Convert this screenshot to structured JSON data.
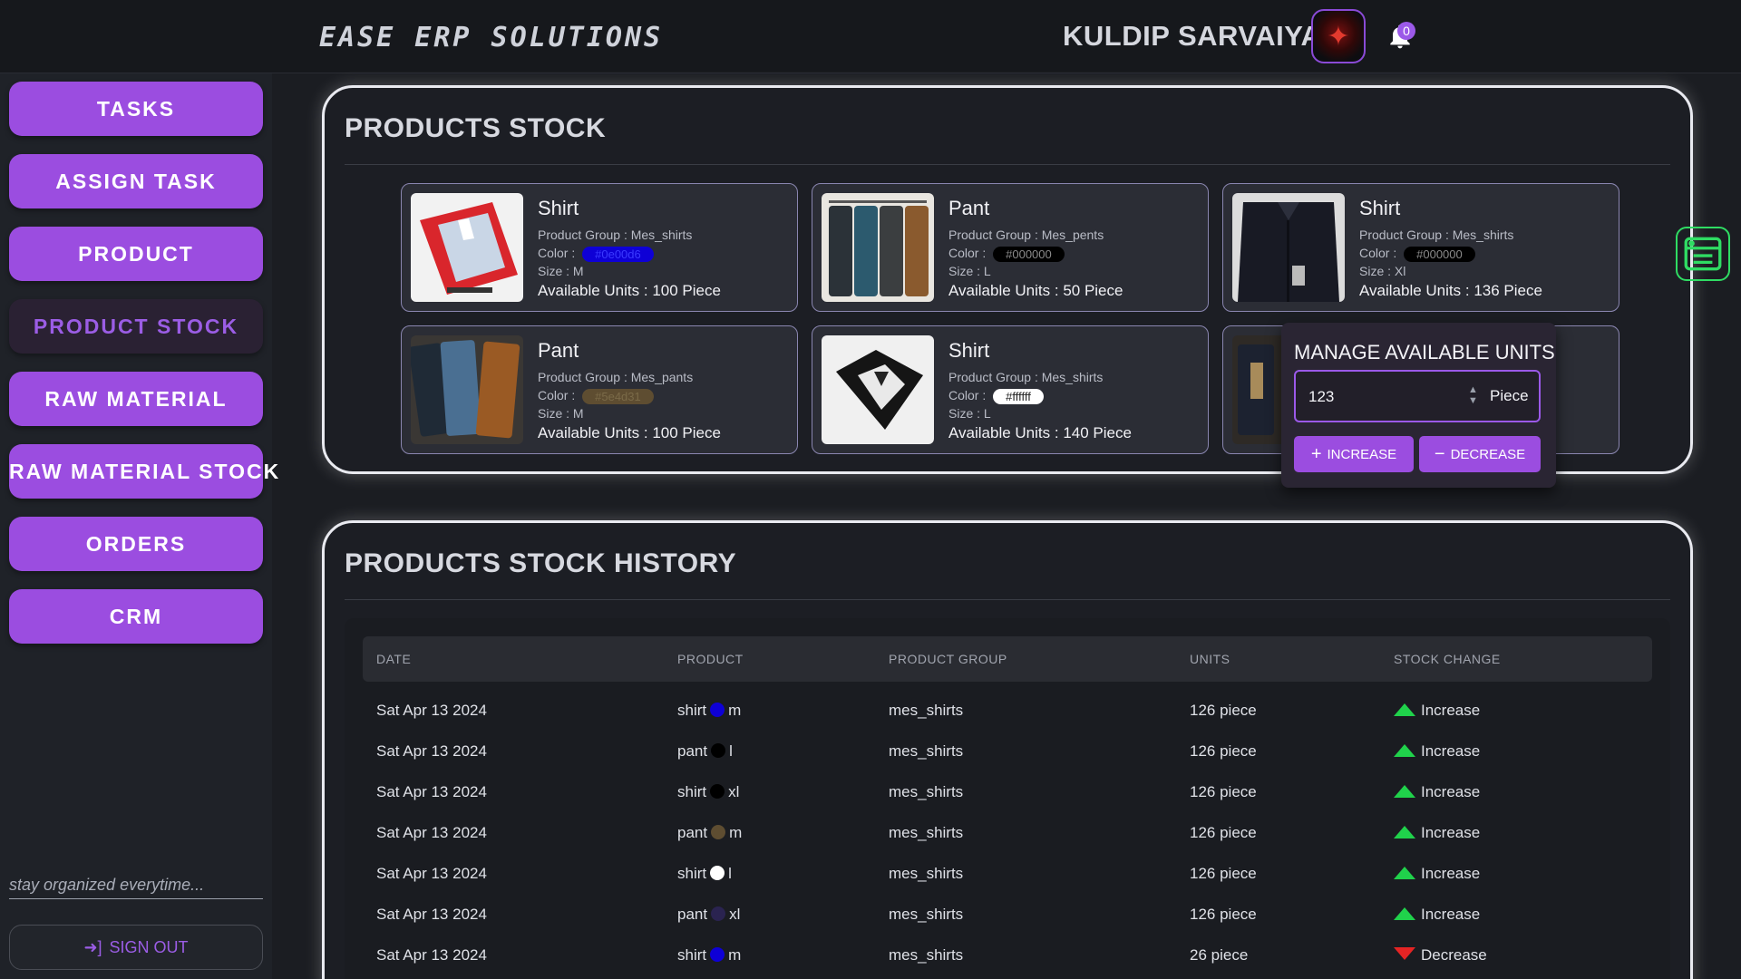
{
  "header": {
    "brand": "EASE ERP SOLUTIONS",
    "user_name": "KULDIP SARVAIYA",
    "notification_count": "0"
  },
  "sidebar": {
    "items": [
      {
        "label": "TASKS",
        "active": false
      },
      {
        "label": "ASSIGN TASK",
        "active": false
      },
      {
        "label": "PRODUCT",
        "active": false
      },
      {
        "label": "PRODUCT STOCK",
        "active": true
      },
      {
        "label": "RAW MATERIAL",
        "active": false
      },
      {
        "label": "RAW MATERIAL STOCK",
        "active": false
      },
      {
        "label": "ORDERS",
        "active": false
      },
      {
        "label": "CRM",
        "active": false
      }
    ],
    "tagline": "stay organized everytime...",
    "signout_label": "SIGN OUT"
  },
  "stock": {
    "title": "PRODUCTS STOCK",
    "group_prefix": "Product Group : ",
    "color_prefix": "Color : ",
    "size_prefix": "Size : ",
    "units_prefix": "Available Units : ",
    "cards": [
      {
        "name": "Shirt",
        "group": "Mes_shirts",
        "color": "#0e00d6",
        "size": "M",
        "units": "100 Piece"
      },
      {
        "name": "Pant",
        "group": "Mes_pents",
        "color": "#000000",
        "size": "L",
        "units": "50 Piece"
      },
      {
        "name": "Shirt",
        "group": "Mes_shirts",
        "color": "#000000",
        "size": "Xl",
        "units": "136 Piece"
      },
      {
        "name": "Pant",
        "group": "Mes_pants",
        "color": "#5e4d31",
        "size": "M",
        "units": "100 Piece"
      },
      {
        "name": "Shirt",
        "group": "Mes_shirts",
        "color": "#ffffff",
        "size": "L",
        "units": "140 Piece"
      }
    ]
  },
  "manage": {
    "title": "MANAGE AVAILABLE UNITS",
    "value": "123",
    "unit": "Piece",
    "increase_label": "INCREASE",
    "decrease_label": "DECREASE"
  },
  "history": {
    "title": "PRODUCTS STOCK HISTORY",
    "columns": [
      "DATE",
      "PRODUCT",
      "PRODUCT GROUP",
      "UNITS",
      "STOCK CHANGE"
    ],
    "rows": [
      {
        "date": "Sat Apr 13 2024",
        "product": "shirt",
        "color": "#0e00d6",
        "size": "m",
        "group": "mes_shirts",
        "units": "126 piece",
        "change": "Increase"
      },
      {
        "date": "Sat Apr 13 2024",
        "product": "pant",
        "color": "#000000",
        "size": "l",
        "group": "mes_shirts",
        "units": "126 piece",
        "change": "Increase"
      },
      {
        "date": "Sat Apr 13 2024",
        "product": "shirt",
        "color": "#000000",
        "size": "xl",
        "group": "mes_shirts",
        "units": "126 piece",
        "change": "Increase"
      },
      {
        "date": "Sat Apr 13 2024",
        "product": "pant",
        "color": "#5e4d31",
        "size": "m",
        "group": "mes_shirts",
        "units": "126 piece",
        "change": "Increase"
      },
      {
        "date": "Sat Apr 13 2024",
        "product": "shirt",
        "color": "#ffffff",
        "size": "l",
        "group": "mes_shirts",
        "units": "126 piece",
        "change": "Increase"
      },
      {
        "date": "Sat Apr 13 2024",
        "product": "pant",
        "color": "#2a2350",
        "size": "xl",
        "group": "mes_shirts",
        "units": "126 piece",
        "change": "Increase"
      },
      {
        "date": "Sat Apr 13 2024",
        "product": "shirt",
        "color": "#0e00d6",
        "size": "m",
        "group": "mes_shirts",
        "units": "26 piece",
        "change": "Decrease"
      }
    ]
  },
  "colors": {
    "accent": "#9b4de0",
    "increase": "#20d24b",
    "decrease": "#e52424"
  }
}
